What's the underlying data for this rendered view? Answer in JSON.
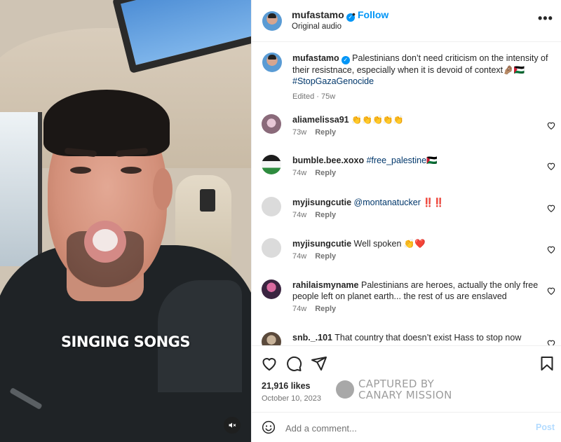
{
  "header": {
    "username": "mufastamo",
    "dot": "•",
    "follow_label": "Follow",
    "subtitle": "Original audio",
    "more": "•••"
  },
  "video": {
    "caption": "SINGING SONGS"
  },
  "post_caption": {
    "username": "mufastamo",
    "text": "Palestinians don’t need criticism on the intensity of their resistnace, especially when it is devoid of context🤌🏽🇵🇸",
    "hashtag": "#StopGazaGenocide",
    "meta": "Edited · 75w"
  },
  "comments": [
    {
      "username": "aliamelissa91",
      "mention": "",
      "text": "👏👏👏👏👏",
      "age": "73w",
      "reply": "Reply"
    },
    {
      "username": "bumble.bee.xoxo",
      "mention": "#free_palestine🇵🇸",
      "text": "",
      "age": "74w",
      "reply": "Reply"
    },
    {
      "username": "myjisungcutie",
      "mention": "@montanatucker",
      "text": "‼️‼️",
      "age": "74w",
      "reply": "Reply"
    },
    {
      "username": "myjisungcutie",
      "mention": "",
      "text": "Well spoken 👏❤️",
      "age": "74w",
      "reply": "Reply"
    },
    {
      "username": "rahilaismyname",
      "mention": "",
      "text": "Palestinians are heroes, actually the only free people left on planet earth... the rest of us are enslaved",
      "age": "74w",
      "reply": "Reply"
    },
    {
      "username": "snb._.101",
      "mention": "",
      "text": "That country that doesn’t exist Hass to stop now",
      "age": "",
      "reply": ""
    }
  ],
  "stats": {
    "likes": "21,916 likes",
    "date": "October 10, 2023"
  },
  "watermark": {
    "line1": "CAPTURED BY",
    "line2": "CANARY MISSION"
  },
  "add_comment": {
    "placeholder": "Add a comment...",
    "post_label": "Post"
  },
  "colors": {
    "accent": "#0095f6",
    "text": "#262626",
    "muted": "#737373",
    "hashtag": "#00376b",
    "post_disabled": "#b3dbff"
  },
  "icons": [
    "verified-icon",
    "more-icon",
    "heart-icon",
    "comment-icon",
    "share-icon",
    "bookmark-icon",
    "emoji-icon",
    "mute-icon"
  ]
}
